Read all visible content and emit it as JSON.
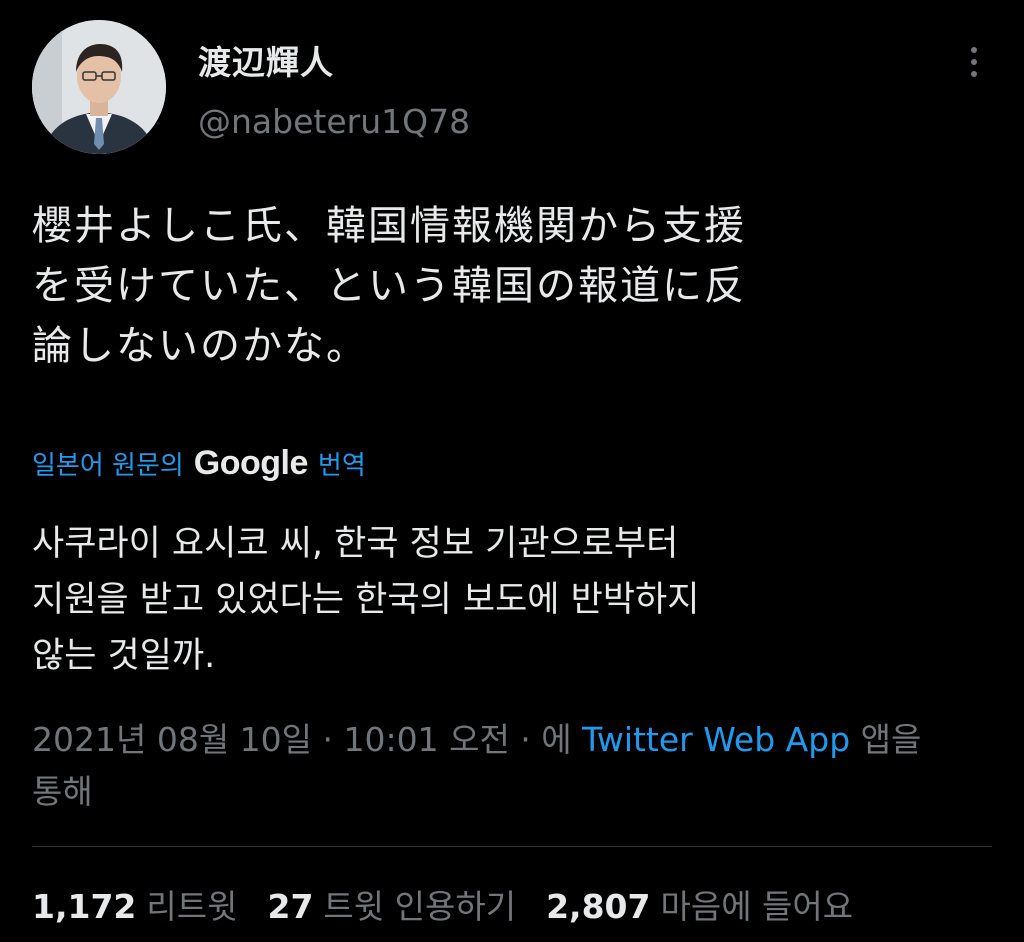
{
  "author": {
    "name": "渡辺輝人",
    "handle": "@nabeteru1Q78"
  },
  "tweet": {
    "lines": [
      "櫻井よしこ氏、韓国情報機関から支援",
      "を受けていた、という韓国の報道に反",
      "論しないのかな。"
    ]
  },
  "translation": {
    "prefix": "일본어 원문의",
    "brand": "Google",
    "suffix": "번역",
    "lines": [
      "사쿠라이 요시코 씨, 한국 정보 기관으로부터",
      "지원을 받고 있었다는 한국의 보도에 반박하지",
      "않는 것일까."
    ]
  },
  "meta": {
    "datetime": "2021년 08월 10일 · 10:01 오전 · 에",
    "app": "Twitter Web App",
    "via_1": "앱을",
    "via_2": "통해"
  },
  "stats": [
    {
      "count": "1,172",
      "label": "리트윗"
    },
    {
      "count": "27",
      "label": "트윗 인용하기"
    },
    {
      "count": "2,807",
      "label": "마음에 들어요"
    }
  ],
  "icons": {
    "more": "more-vertical-icon"
  }
}
